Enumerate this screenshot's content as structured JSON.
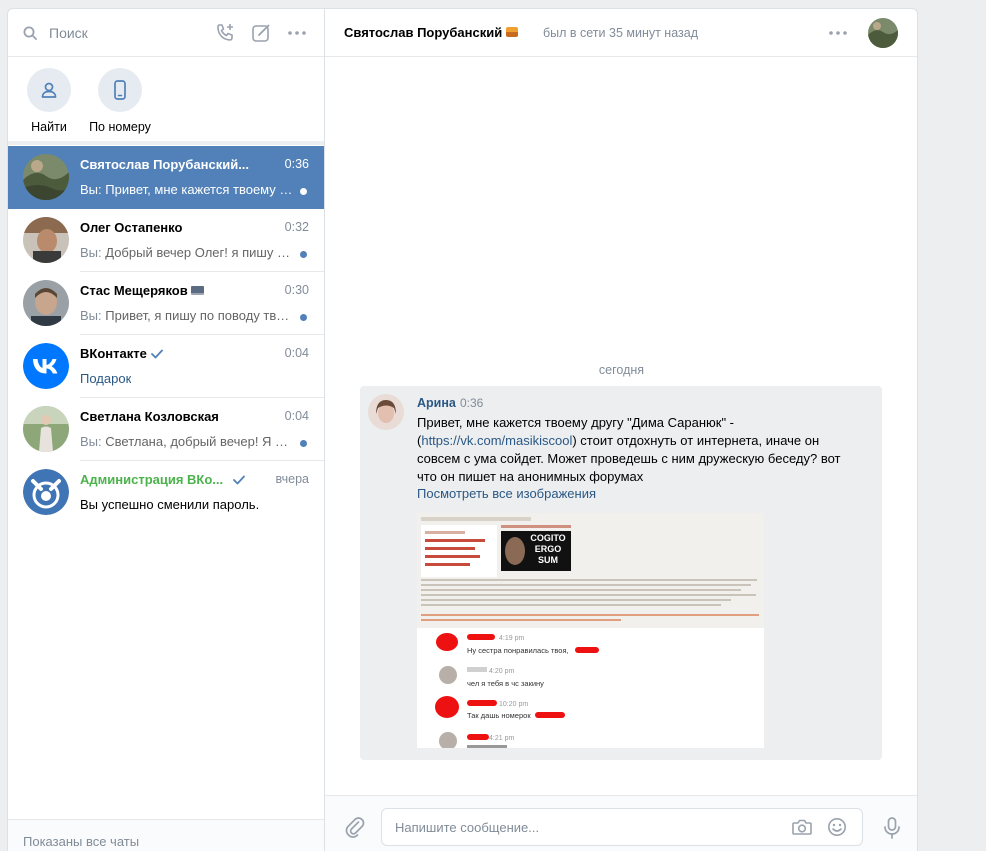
{
  "search": {
    "placeholder": "Поиск"
  },
  "quick_actions": [
    {
      "label": "Найти",
      "icon": "user-icon"
    },
    {
      "label": "По номеру",
      "icon": "phone-icon"
    }
  ],
  "chats": [
    {
      "name": "Святослав Порубанский...",
      "time": "0:36",
      "you": "Вы:",
      "preview": " Привет, мне кажется твоему д...",
      "active": true
    },
    {
      "name": "Олег Остапенко",
      "time": "0:32",
      "you": "Вы:",
      "preview": " Добрый вечер Олег! я пишу по..."
    },
    {
      "name": "Стас Мещеряков",
      "time": "0:30",
      "you": "Вы:",
      "preview": " Привет, я пишу по поводу твое..."
    },
    {
      "name": "ВКонтакте",
      "time": "0:04",
      "you": "",
      "preview": "Подарок"
    },
    {
      "name": "Светлана Козловская",
      "time": "0:04",
      "you": "Вы:",
      "preview": " Светлана, добрый вечер! Я яв..."
    },
    {
      "name": "Администрация ВКо...",
      "time": "вчера",
      "you": "",
      "preview": "Вы успешно сменили пароль."
    }
  ],
  "footer": {
    "label": "Показаны все чаты"
  },
  "header": {
    "title": "Святослав Порубанский",
    "status": "был в сети 35 минут назад"
  },
  "date_separator": "сегодня",
  "message": {
    "author": "Арина",
    "time": "0:36",
    "text_before": "Привет, мне кажется твоему другу \"Дима Саранюк\" - (",
    "link": "https://vk.com/masikiscool",
    "text_after": ") стоит отдохнуть от интернета, иначе он совсем с ума сойдет. Может проведешь с ним дружескую беседу? вот что он пишет на анонимных форумах",
    "view_all": "Посмотреть все изображения",
    "attachment": {
      "cogito": [
        "COGITO",
        "ERGO",
        "SUM"
      ],
      "lines": [
        {
          "time": "4:19 pm",
          "text": "Ну сестра понравилась твоя,"
        },
        {
          "time": "4:20 pm",
          "text": "чел я тебя в чс закину"
        },
        {
          "time": "10:20 pm",
          "text": "Так дашь номерок"
        },
        {
          "time": "4:21 pm",
          "text": ""
        }
      ]
    }
  },
  "composer": {
    "placeholder": "Напишите сообщение..."
  },
  "colors": {
    "accent": "#5181b8",
    "link": "#2a5885",
    "verified": "#5181b8",
    "admin_green": "#4bb34b",
    "muted": "#818c99"
  }
}
